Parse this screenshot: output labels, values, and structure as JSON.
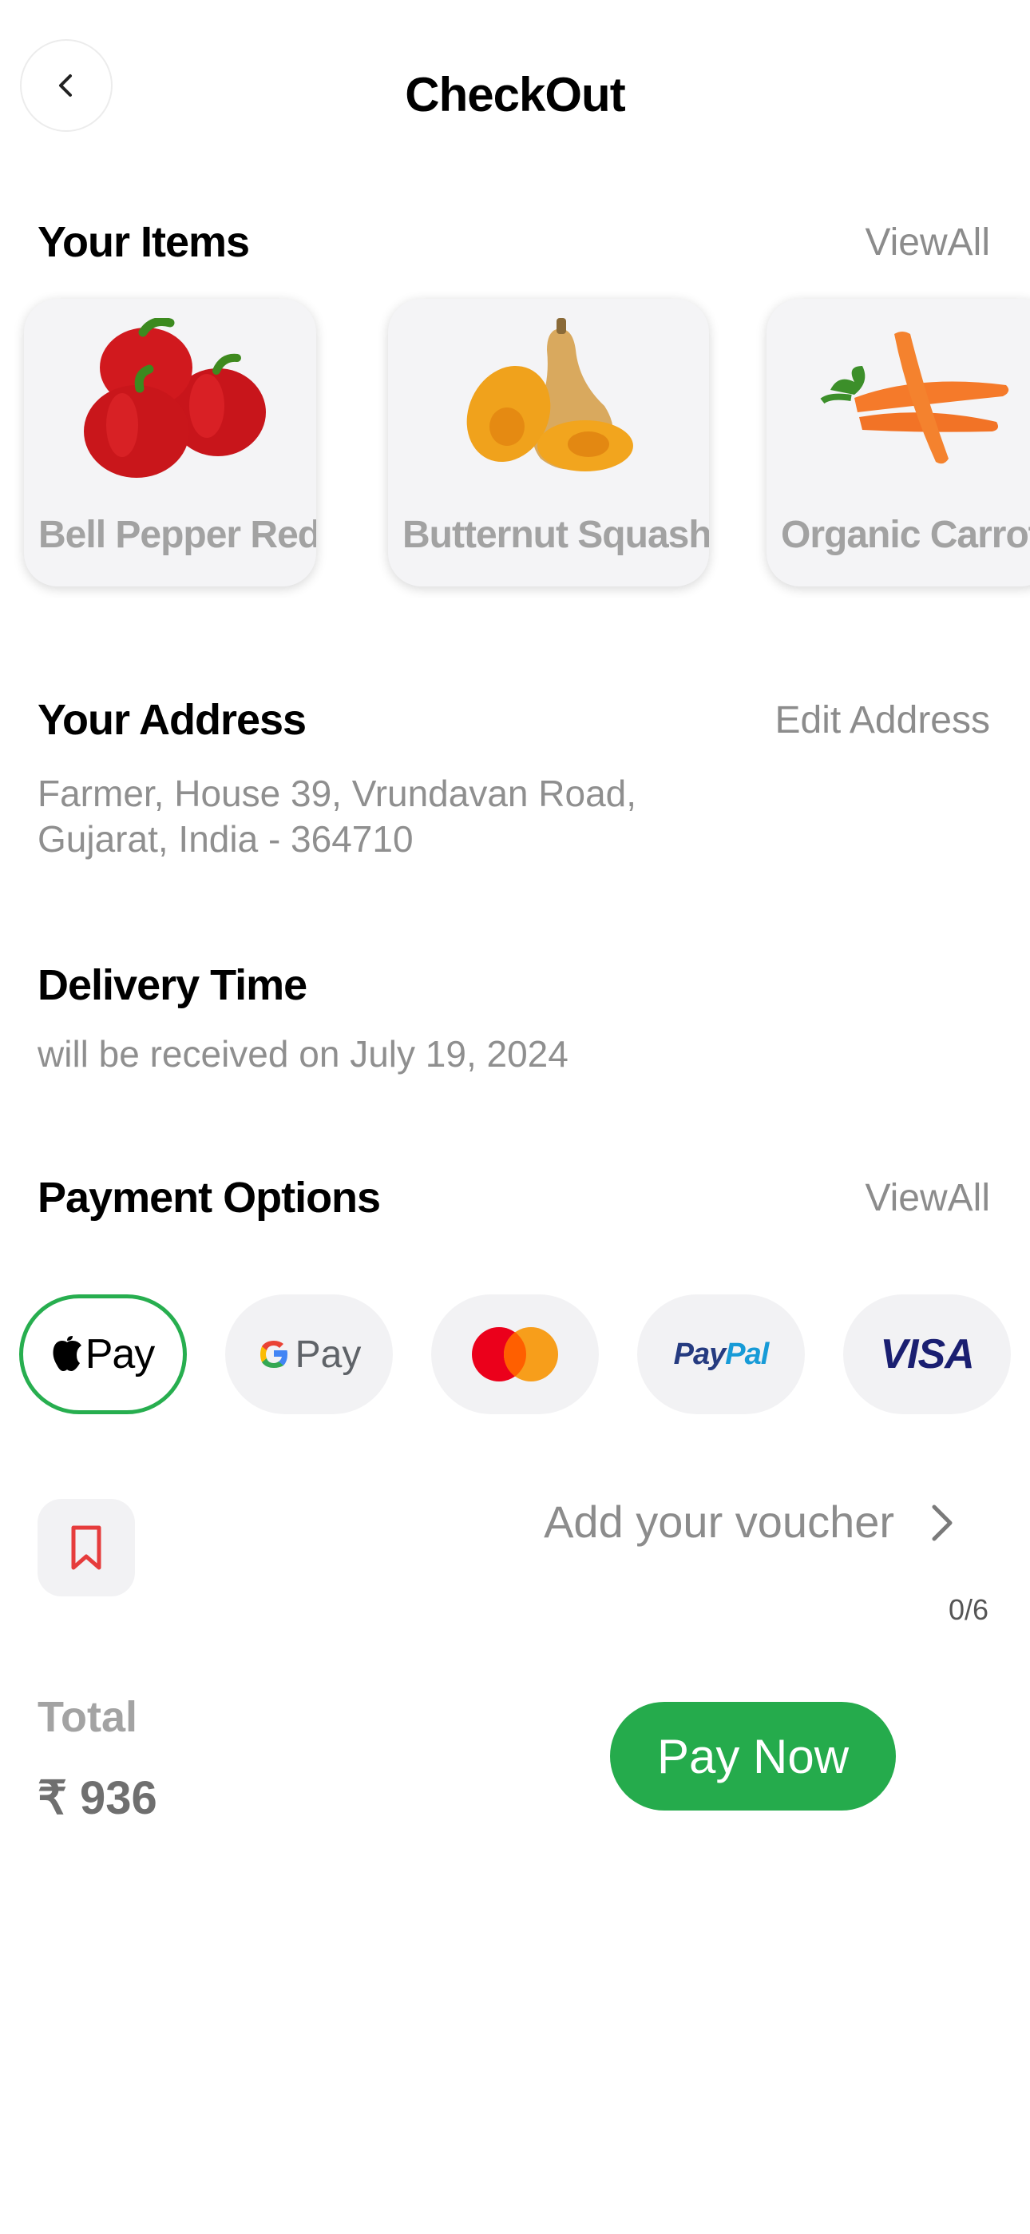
{
  "header": {
    "title": "CheckOut",
    "back_icon": "chevron-left-icon"
  },
  "items": {
    "title": "Your Items",
    "view_all": "ViewAll",
    "list": [
      {
        "name": "Bell Pepper Red",
        "image": "bell-pepper-red-image"
      },
      {
        "name": "Butternut Squash",
        "image": "butternut-squash-image"
      },
      {
        "name": "Organic Carrot",
        "image": "organic-carrot-image"
      }
    ]
  },
  "address": {
    "title": "Your Address",
    "edit": "Edit Address",
    "line1": "Farmer, House 39, Vrundavan Road,",
    "line2": "Gujarat, India - 364710"
  },
  "delivery": {
    "title": "Delivery Time",
    "text": "will be received on July 19, 2024"
  },
  "payment": {
    "title": "Payment Options",
    "view_all": "ViewAll",
    "selected": "Apple Pay",
    "options": [
      {
        "name": "Apple Pay",
        "label": "Pay"
      },
      {
        "name": "Google Pay",
        "label": "Pay"
      },
      {
        "name": "Mastercard"
      },
      {
        "name": "PayPal",
        "label": "PayPal"
      },
      {
        "name": "Visa",
        "label": "VISA"
      }
    ]
  },
  "voucher": {
    "text": "Add your voucher",
    "counter": "0/6",
    "icon": "bookmark-icon"
  },
  "total": {
    "label": "Total",
    "value": "₹ 936"
  },
  "cta": {
    "label": "Pay Now"
  },
  "colors": {
    "accent": "#25ab4c",
    "selected_border": "#27ae4f",
    "muted_text": "#8c8c8c",
    "icon_red": "#e63c3c"
  }
}
